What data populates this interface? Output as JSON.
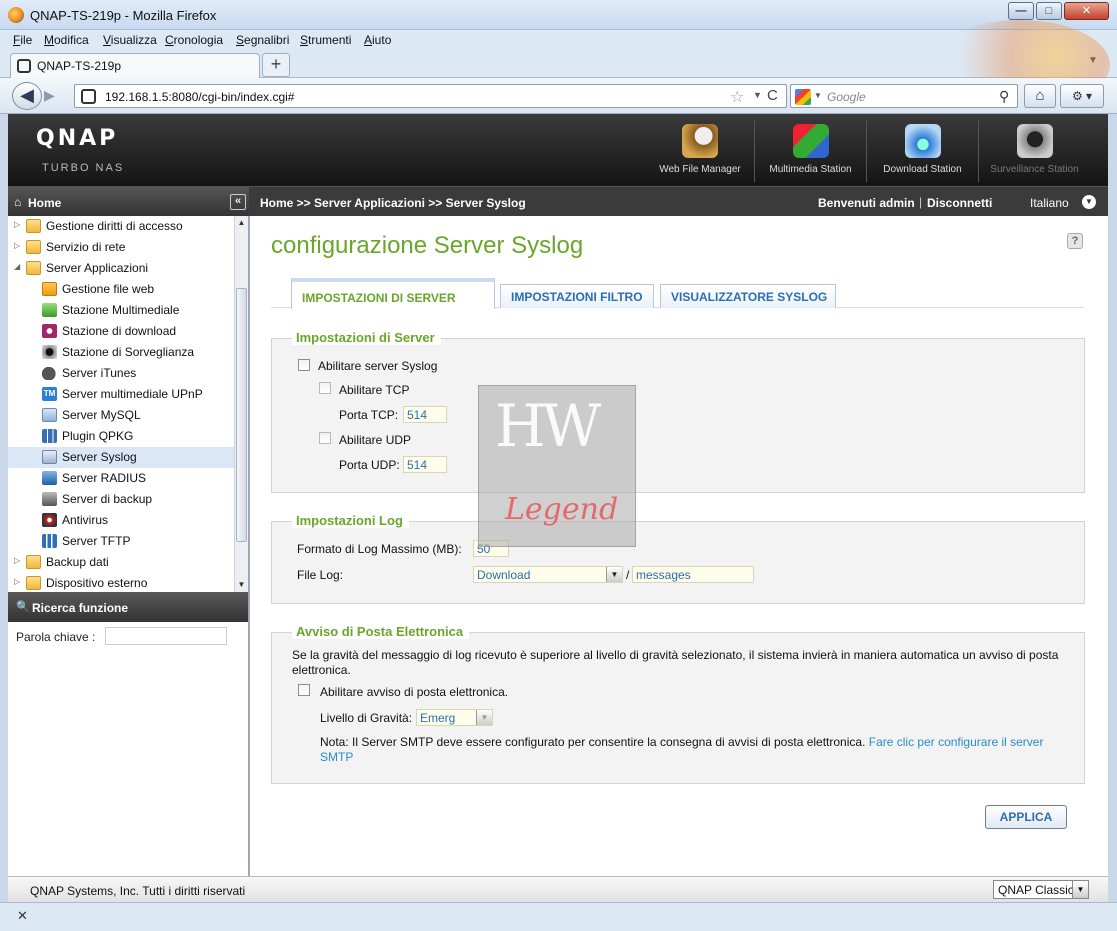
{
  "window": {
    "title": "QNAP-TS-219p - Mozilla Firefox",
    "minimize": "—",
    "maximize": "□",
    "close": "✕"
  },
  "menu": [
    "File",
    "Modifica",
    "Visualizza",
    "Cronologia",
    "Segnalibri",
    "Strumenti",
    "Aiuto"
  ],
  "tab": {
    "label": "QNAP-TS-219p",
    "new_tab": "+",
    "list": "▼"
  },
  "nav": {
    "back": "◀",
    "forward": "▶",
    "url": "192.168.1.5:8080/cgi-bin/index.cgi#",
    "star": "☆",
    "drop": "▼",
    "reload": "C",
    "search_placeholder": "Google",
    "search_drop": "▼",
    "search_go": "⚲",
    "home": "⌂",
    "addon": "⚙ ▾"
  },
  "qnap": {
    "logo": "QNAP",
    "subtitle": "TURBO NAS",
    "apps": [
      "Web File Manager",
      "Multimedia Station",
      "Download Station",
      "Surveillance Station"
    ]
  },
  "topbar": {
    "home_icon": "⌂",
    "home": "Home",
    "collapse": "«",
    "breadcrumb": "Home >> Server Applicazioni >> Server Syslog",
    "welcome": "Benvenuti admin",
    "separator": "|",
    "logout": "Disconnetti",
    "language": "Italiano",
    "language_drop": "▼"
  },
  "sidebar": {
    "items": [
      {
        "label": "Gestione diritti di accesso",
        "arrow": "▷"
      },
      {
        "label": "Servizio di rete",
        "arrow": "▷"
      },
      {
        "label": "Server Applicazioni",
        "arrow": "◢"
      },
      {
        "label": "Gestione file web"
      },
      {
        "label": "Stazione Multimediale"
      },
      {
        "label": "Stazione di download"
      },
      {
        "label": "Stazione di Sorveglianza"
      },
      {
        "label": "Server iTunes"
      },
      {
        "label": "Server multimediale UPnP",
        "icon_text": "TM"
      },
      {
        "label": "Server MySQL"
      },
      {
        "label": "Plugin QPKG"
      },
      {
        "label": "Server Syslog"
      },
      {
        "label": "Server RADIUS"
      },
      {
        "label": "Server di backup"
      },
      {
        "label": "Antivirus"
      },
      {
        "label": "Server TFTP"
      },
      {
        "label": "Backup dati",
        "arrow": "▷"
      },
      {
        "label": "Dispositivo esterno",
        "arrow": "▷"
      }
    ],
    "scroll_up": "▲",
    "scroll_down": "▼",
    "search_icon": "🔍",
    "search_title": "Ricerca funzione",
    "keyword_label": "Parola chiave :",
    "keyword_value": ""
  },
  "main": {
    "title": "configurazione Server Syslog",
    "help": "?",
    "tabs": [
      "IMPOSTAZIONI DI SERVER",
      "IMPOSTAZIONI FILTRO",
      "VISUALIZZATORE SYSLOG"
    ],
    "server": {
      "legend": "Impostazioni di Server",
      "enable_syslog": "Abilitare server Syslog",
      "enable_tcp": "Abilitare TCP",
      "tcp_port_label": "Porta TCP:",
      "tcp_port": "514",
      "enable_udp": "Abilitare UDP",
      "udp_port_label": "Porta UDP:",
      "udp_port": "514"
    },
    "log": {
      "legend": "Impostazioni Log",
      "max_size_label": "Formato di Log Massimo (MB):",
      "max_size": "50",
      "file_label": "File Log:",
      "folder": "Download",
      "slash": "/",
      "filename": "messages",
      "arrow": "▼"
    },
    "email": {
      "legend": "Avviso di Posta Elettronica",
      "description": "Se la gravità del messaggio di log ricevuto è superiore al livello di gravità selezionato, il sistema invierà in maniera automatica un avviso di posta elettronica.",
      "enable_label": "Abilitare avviso di posta elettronica.",
      "severity_label": "Livello di Gravità:",
      "severity": "Emerg",
      "note": "Nota: Il Server SMTP deve essere configurato per consentire la consegna di avvisi di posta elettronica. ",
      "note_link": "Fare clic per configurare il server SMTP"
    },
    "apply": "APPLICA"
  },
  "watermark": {
    "top": "HW",
    "bottom": "Legend"
  },
  "footer": {
    "copyright": "QNAP Systems, Inc. Tutti i diritti riservati",
    "theme": "QNAP Classic",
    "theme_drop": "▼"
  },
  "status": {
    "close": "✕"
  }
}
